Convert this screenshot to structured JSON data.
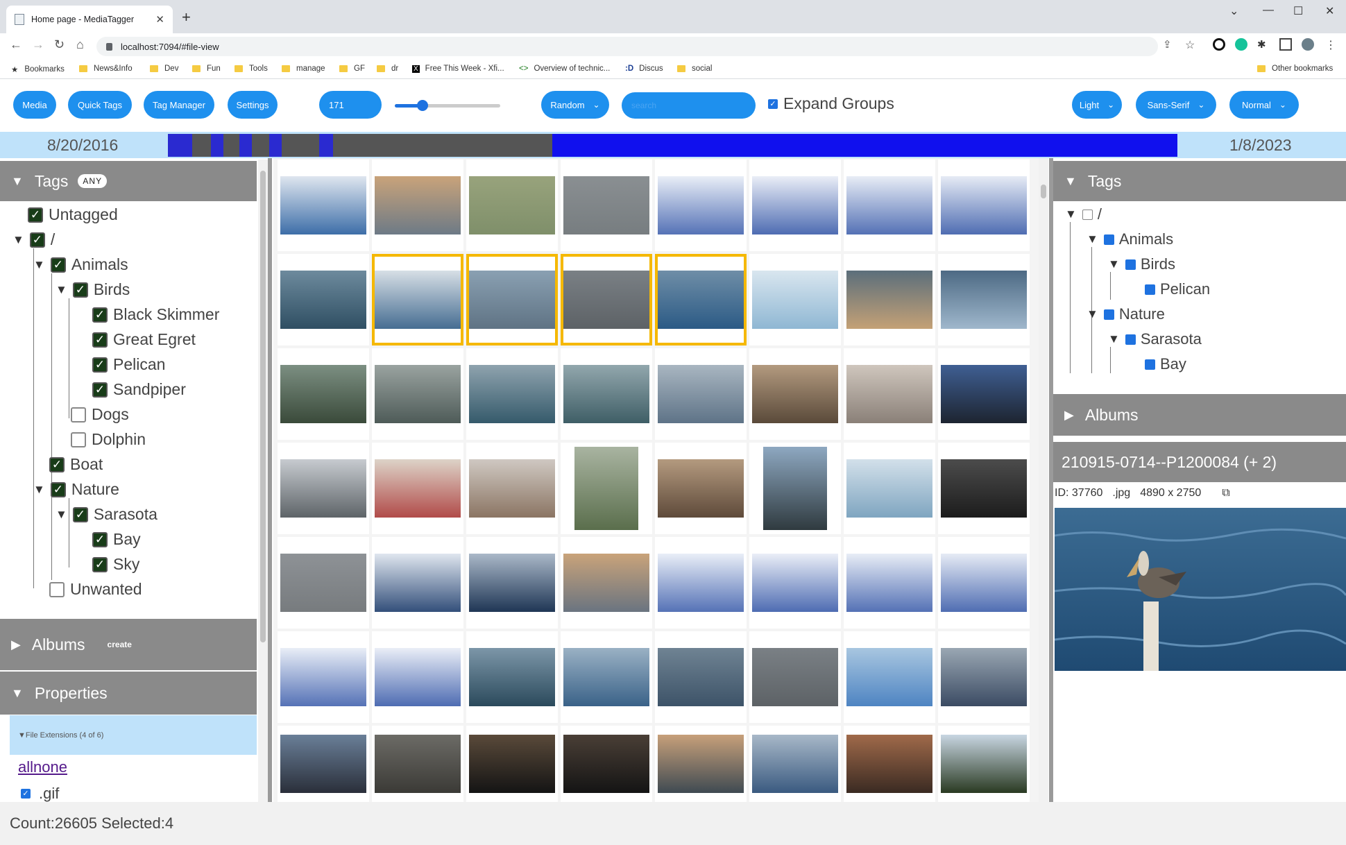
{
  "browser": {
    "tab_title": "Home page - MediaTagger",
    "url": "localhost:7094/#file-view",
    "bookmarks": [
      "Bookmarks",
      "News&Info",
      "Dev",
      "Fun",
      "Tools",
      "manage",
      "GF",
      "dr",
      "Free This Week - Xfi...",
      "Overview of technic...",
      "Discus",
      "social"
    ],
    "other_bookmarks": "Other bookmarks"
  },
  "toolbar": {
    "media": "Media",
    "quick_tags": "Quick Tags",
    "tag_manager": "Tag Manager",
    "settings": "Settings",
    "count": "171",
    "zoom_level": 0.26,
    "sort": "Random",
    "search_placeholder": "search",
    "expand_groups": "Expand Groups",
    "theme": "Light",
    "font": "Sans-Serif",
    "size": "Normal"
  },
  "timeline": {
    "start": "8/20/2016",
    "end": "1/8/2023"
  },
  "left": {
    "tags_header": "Tags",
    "any_badge": "ANY",
    "tree": {
      "untagged": "Untagged",
      "root": "/",
      "animals": "Animals",
      "birds": "Birds",
      "black_skimmer": "Black Skimmer",
      "great_egret": "Great Egret",
      "pelican": "Pelican",
      "sandpiper": "Sandpiper",
      "dogs": "Dogs",
      "dolphin": "Dolphin",
      "boat": "Boat",
      "nature": "Nature",
      "sarasota": "Sarasota",
      "bay": "Bay",
      "sky": "Sky",
      "unwanted": "Unwanted"
    },
    "albums_header": "Albums",
    "create": "create",
    "properties_header": "Properties",
    "file_extensions": "▼File Extensions (4 of 6)",
    "allnone": "allnone",
    "gif": ".gif"
  },
  "right": {
    "tags_header": "Tags",
    "root": "/",
    "animals": "Animals",
    "birds": "Birds",
    "pelican": "Pelican",
    "nature": "Nature",
    "sarasota": "Sarasota",
    "bay": "Bay",
    "albums_header": "Albums",
    "file_title": "210915-0714--P1200084 (+ 2)",
    "id": "ID: 37760",
    "ext": ".jpg",
    "dims": "4890 x 2750"
  },
  "status": {
    "text": "Count:26605 Selected:4"
  },
  "colors": {
    "accent": "#1e90ee",
    "selection": "#f5b800",
    "panel_header": "#8a8a8a",
    "timeline_bg": "#bfe2fa"
  }
}
